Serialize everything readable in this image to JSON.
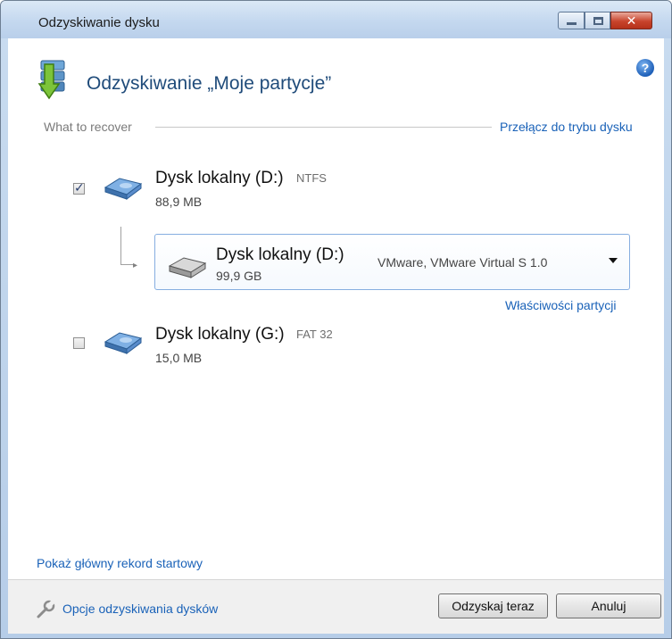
{
  "window": {
    "title": "Odzyskiwanie dysku"
  },
  "header": {
    "title": "Odzyskiwanie „Moje partycje”",
    "help_icon": "?"
  },
  "section": {
    "label": "What to recover",
    "switch_link": "Przełącz do trybu dysku"
  },
  "partitions": [
    {
      "name": "Dysk lokalny (D:)",
      "fs": "NTFS",
      "size": "88,9 MB",
      "checked": true
    },
    {
      "name": "Dysk lokalny (G:)",
      "fs": "FAT 32",
      "size": "15,0 MB",
      "checked": false
    }
  ],
  "target": {
    "name": "Dysk lokalny (D:)",
    "size": "99,9 GB",
    "model": "VMware, VMware Virtual S 1.0"
  },
  "properties_link": "Właściwości partycji",
  "mbr_link": "Pokaż główny rekord startowy",
  "footer": {
    "options_link": "Opcje odzyskiwania dysków",
    "recover_button": "Odzyskaj teraz",
    "cancel_button": "Anuluj"
  },
  "colors": {
    "link": "#1a62b8",
    "title": "#1f4b7a"
  }
}
